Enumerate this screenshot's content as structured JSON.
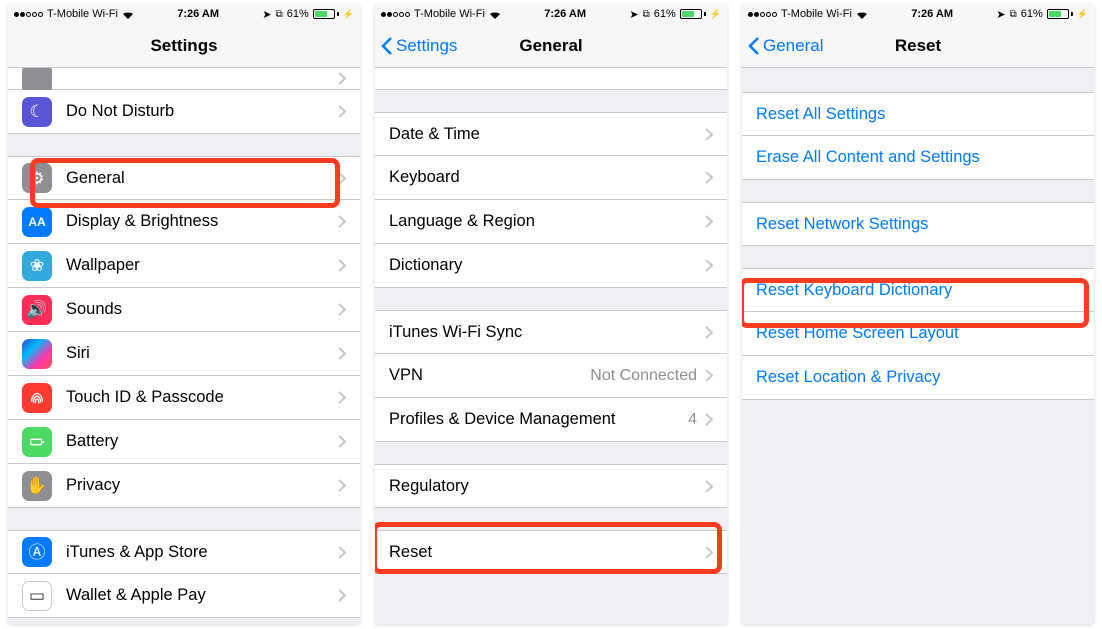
{
  "status": {
    "carrier": "T-Mobile Wi-Fi",
    "time": "7:26 AM",
    "battery_pct": "61%"
  },
  "screen1": {
    "title": "Settings",
    "row_cut": "",
    "rows_g1": [
      {
        "label": "Do Not Disturb",
        "icon": "moon"
      }
    ],
    "rows_g2": [
      {
        "label": "General",
        "icon": "gear",
        "hl": true
      },
      {
        "label": "Display & Brightness",
        "icon": "text"
      },
      {
        "label": "Wallpaper",
        "icon": "flower"
      },
      {
        "label": "Sounds",
        "icon": "speaker"
      },
      {
        "label": "Siri",
        "icon": "siri"
      },
      {
        "label": "Touch ID & Passcode",
        "icon": "finger"
      },
      {
        "label": "Battery",
        "icon": "batt"
      },
      {
        "label": "Privacy",
        "icon": "hand"
      }
    ],
    "rows_g3": [
      {
        "label": "iTunes & App Store",
        "icon": "appstore"
      },
      {
        "label": "Wallet & Apple Pay",
        "icon": "wallet"
      }
    ]
  },
  "screen2": {
    "back": "Settings",
    "title": "General",
    "g1": [
      {
        "label": "Date & Time"
      },
      {
        "label": "Keyboard"
      },
      {
        "label": "Language & Region"
      },
      {
        "label": "Dictionary"
      }
    ],
    "g2": [
      {
        "label": "iTunes Wi-Fi Sync"
      },
      {
        "label": "VPN",
        "detail": "Not Connected"
      },
      {
        "label": "Profiles & Device Management",
        "detail": "4"
      }
    ],
    "g3": [
      {
        "label": "Regulatory"
      }
    ],
    "g4": [
      {
        "label": "Reset",
        "hl": true
      }
    ]
  },
  "screen3": {
    "back": "General",
    "title": "Reset",
    "g1": [
      {
        "label": "Reset All Settings"
      },
      {
        "label": "Erase All Content and Settings"
      }
    ],
    "g2": [
      {
        "label": "Reset Network Settings"
      }
    ],
    "g3": [
      {
        "label": "Reset Keyboard Dictionary",
        "hl": true
      },
      {
        "label": "Reset Home Screen Layout"
      },
      {
        "label": "Reset Location & Privacy"
      }
    ]
  }
}
